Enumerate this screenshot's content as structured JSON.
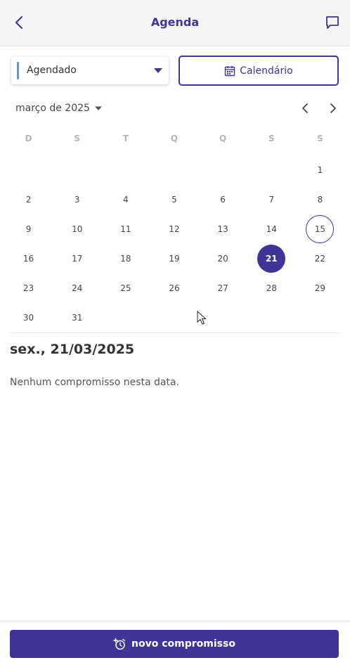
{
  "colors": {
    "primary": "#3f3596",
    "filter_accent": "#6c8fd6",
    "weekday_text": "#b4b4b8"
  },
  "header": {
    "title": "Agenda",
    "back_icon": "chevron-left-icon",
    "chat_icon": "chat-bubble-icon"
  },
  "filter": {
    "selected": "Agendado"
  },
  "calendar_button": {
    "label": "Calendário",
    "icon": "calendar-icon"
  },
  "month": {
    "label": "março de 2025"
  },
  "weekdays": [
    "D",
    "S",
    "T",
    "Q",
    "Q",
    "S",
    "S"
  ],
  "weeks": [
    [
      "",
      "",
      "",
      "",
      "",
      "",
      "1"
    ],
    [
      "2",
      "3",
      "4",
      "5",
      "6",
      "7",
      "8"
    ],
    [
      "9",
      "10",
      "11",
      "12",
      "13",
      "14",
      "15"
    ],
    [
      "16",
      "17",
      "18",
      "19",
      "20",
      "21",
      "22"
    ],
    [
      "23",
      "24",
      "25",
      "26",
      "27",
      "28",
      "29"
    ],
    [
      "30",
      "31",
      "",
      "",
      "",
      "",
      ""
    ]
  ],
  "today_day": "15",
  "selected_day": "21",
  "selected_date": {
    "title": "sex., 21/03/2025",
    "empty_message": "Nenhum compromisso nesta data."
  },
  "footer": {
    "new_button_label": "novo compromisso",
    "new_button_icon": "alarm-add-icon"
  }
}
